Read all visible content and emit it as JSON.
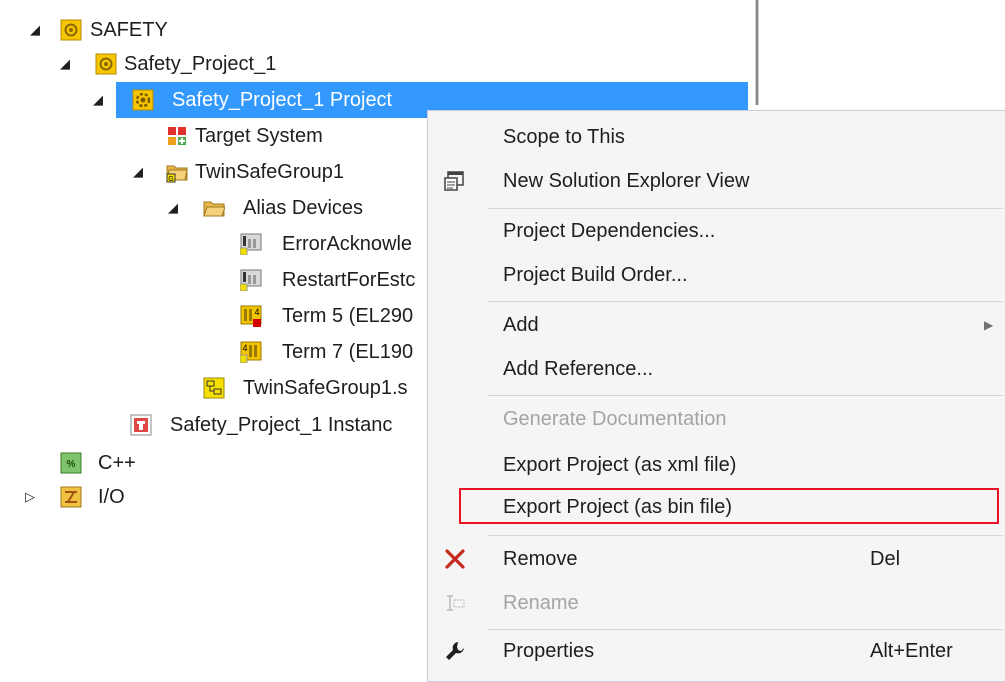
{
  "tree": {
    "items": [
      {
        "label": "SAFETY"
      },
      {
        "label": "Safety_Project_1"
      },
      {
        "label": "Safety_Project_1 Project"
      },
      {
        "label": "Target System"
      },
      {
        "label": "TwinSafeGroup1"
      },
      {
        "label": "Alias Devices"
      },
      {
        "label": "ErrorAcknowle"
      },
      {
        "label": "RestartForEstc"
      },
      {
        "label": "Term 5 (EL290"
      },
      {
        "label": "Term 7 (EL190"
      },
      {
        "label": "TwinSafeGroup1.s"
      },
      {
        "label": "Safety_Project_1 Instanc"
      },
      {
        "label": "C++"
      },
      {
        "label": "I/O"
      }
    ]
  },
  "context_menu": {
    "items": [
      {
        "label": "Scope to This"
      },
      {
        "label": "New Solution Explorer View"
      },
      {
        "label": "Project Dependencies..."
      },
      {
        "label": "Project Build Order..."
      },
      {
        "label": "Add"
      },
      {
        "label": "Add Reference..."
      },
      {
        "label": "Generate Documentation"
      },
      {
        "label": "Export Project (as xml file)"
      },
      {
        "label": "Export Project (as bin file)"
      },
      {
        "label": "Remove",
        "shortcut": "Del"
      },
      {
        "label": "Rename"
      },
      {
        "label": "Properties",
        "shortcut": "Alt+Enter"
      }
    ]
  },
  "colors": {
    "selection": "#3399ff",
    "highlight_box": "#e81123",
    "menu_background": "#f5f5f5",
    "disabled_text": "#a2a4a5",
    "remove_icon": "#c42b1c"
  },
  "icons": {
    "expanded": "triangle-down-icon",
    "collapsed": "triangle-right-icon",
    "submenu": "submenu-arrow-icon"
  }
}
